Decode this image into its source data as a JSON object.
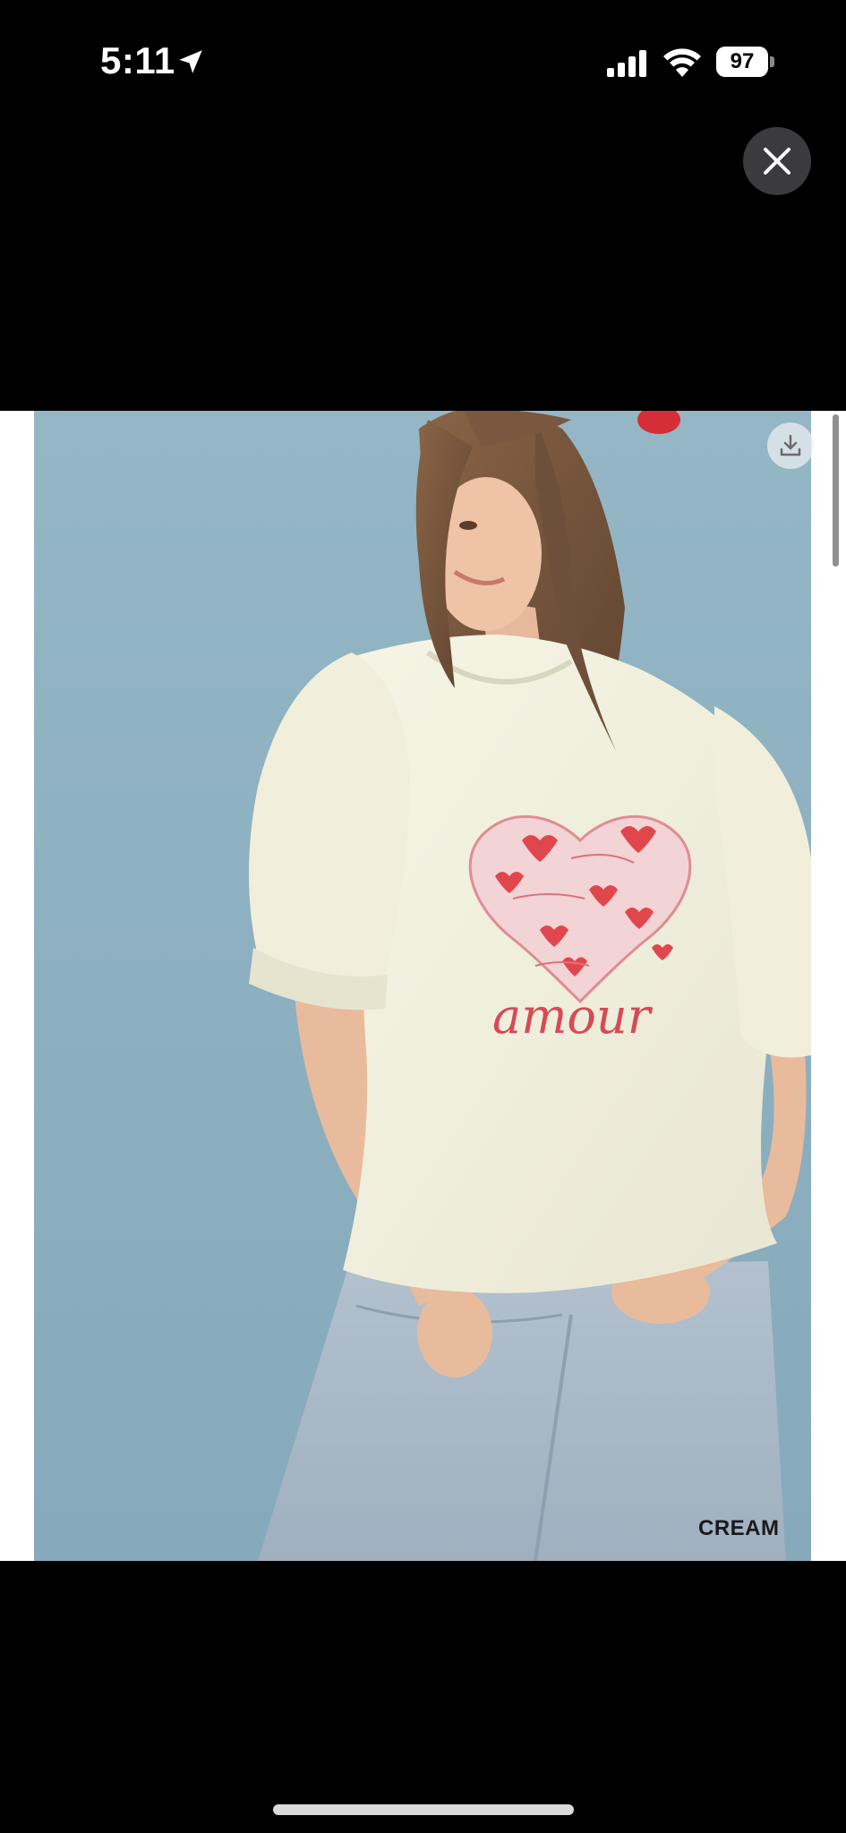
{
  "status_bar": {
    "time": "5:11",
    "battery_level": "97",
    "location_icon": "location-arrow-icon",
    "signal_icon": "cellular-signal-icon",
    "wifi_icon": "wifi-icon"
  },
  "viewer": {
    "close_icon": "close-icon",
    "download_icon": "download-icon",
    "image_description": "Model wearing cream puff-sleeve tee with heart graphic",
    "print_text": "amour",
    "color_label": "CREAM"
  },
  "colors": {
    "background": "#000000",
    "backdrop_blue": "#8fb2c1",
    "shirt_cream": "#f3f1df",
    "heart_red": "#e0474c",
    "denim": "#a9b8c6"
  }
}
